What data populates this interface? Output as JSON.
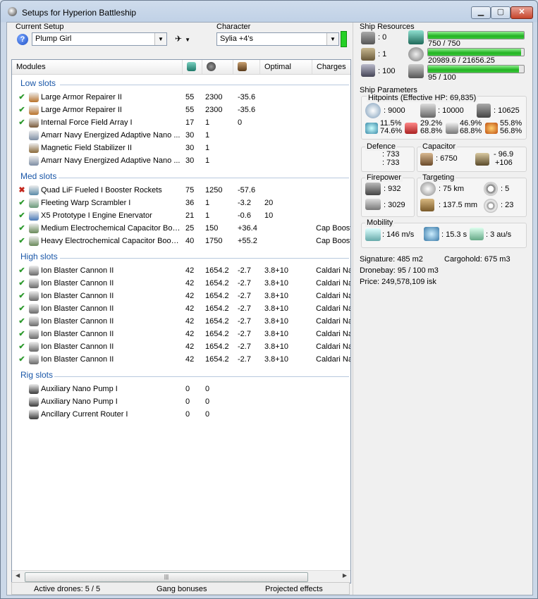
{
  "window": {
    "title": "Setups for Hyperion Battleship"
  },
  "setup": {
    "label": "Current Setup",
    "value": "Plump Girl"
  },
  "character": {
    "label": "Character",
    "value": "Sylia +4's"
  },
  "columns": {
    "modules": "Modules",
    "optimal": "Optimal",
    "charges": "Charges"
  },
  "groups": {
    "low": "Low slots",
    "med": "Med slots",
    "high": "High slots",
    "rig": "Rig slots"
  },
  "low": [
    {
      "s": "on",
      "name": "Large Armor Repairer II",
      "cpu": "55",
      "pg": "2300",
      "cap": "-35.6",
      "opt": "",
      "chg": "",
      "ic": "#b8732b"
    },
    {
      "s": "on",
      "name": "Large Armor Repairer II",
      "cpu": "55",
      "pg": "2300",
      "cap": "-35.6",
      "opt": "",
      "chg": "",
      "ic": "#b8732b"
    },
    {
      "s": "on",
      "name": "Internal Force Field Array I",
      "cpu": "17",
      "pg": "1",
      "cap": "0",
      "opt": "",
      "chg": "",
      "ic": "#7a5a3a"
    },
    {
      "s": "",
      "name": "Amarr Navy Energized Adaptive Nano ...",
      "cpu": "30",
      "pg": "1",
      "cap": "",
      "opt": "",
      "chg": "",
      "ic": "#7e8ea4"
    },
    {
      "s": "",
      "name": "Magnetic Field Stabilizer II",
      "cpu": "30",
      "pg": "1",
      "cap": "",
      "opt": "",
      "chg": "",
      "ic": "#8a6a3a"
    },
    {
      "s": "",
      "name": "Amarr Navy Energized Adaptive Nano ...",
      "cpu": "30",
      "pg": "1",
      "cap": "",
      "opt": "",
      "chg": "",
      "ic": "#7e8ea4"
    }
  ],
  "med": [
    {
      "s": "off",
      "name": "Quad LiF Fueled I Booster Rockets",
      "cpu": "75",
      "pg": "1250",
      "cap": "-57.6",
      "opt": "",
      "chg": "",
      "ic": "#5a8aa8"
    },
    {
      "s": "on",
      "name": "Fleeting Warp Scrambler I",
      "cpu": "36",
      "pg": "1",
      "cap": "-3.2",
      "opt": "20",
      "chg": "",
      "ic": "#6a9a7a"
    },
    {
      "s": "on",
      "name": "X5 Prototype I Engine Enervator",
      "cpu": "21",
      "pg": "1",
      "cap": "-0.6",
      "opt": "10",
      "chg": "",
      "ic": "#4a7ab8"
    },
    {
      "s": "on",
      "name": "Medium Electrochemical Capacitor Boo...",
      "cpu": "25",
      "pg": "150",
      "cap": "+36.4",
      "opt": "",
      "chg": "Cap Booster",
      "ic": "#6a8a5a"
    },
    {
      "s": "on",
      "name": "Heavy Electrochemical Capacitor Boost...",
      "cpu": "40",
      "pg": "1750",
      "cap": "+55.2",
      "opt": "",
      "chg": "Cap Booster",
      "ic": "#6a8a5a"
    }
  ],
  "high": [
    {
      "s": "on",
      "name": "Ion Blaster Cannon II",
      "cpu": "42",
      "pg": "1654.2",
      "cap": "-2.7",
      "opt": "3.8+10",
      "chg": "Caldari Navy",
      "ic": "#6a6a6a"
    },
    {
      "s": "on",
      "name": "Ion Blaster Cannon II",
      "cpu": "42",
      "pg": "1654.2",
      "cap": "-2.7",
      "opt": "3.8+10",
      "chg": "Caldari Navy",
      "ic": "#6a6a6a"
    },
    {
      "s": "on",
      "name": "Ion Blaster Cannon II",
      "cpu": "42",
      "pg": "1654.2",
      "cap": "-2.7",
      "opt": "3.8+10",
      "chg": "Caldari Navy",
      "ic": "#6a6a6a"
    },
    {
      "s": "on",
      "name": "Ion Blaster Cannon II",
      "cpu": "42",
      "pg": "1654.2",
      "cap": "-2.7",
      "opt": "3.8+10",
      "chg": "Caldari Navy",
      "ic": "#6a6a6a"
    },
    {
      "s": "on",
      "name": "Ion Blaster Cannon II",
      "cpu": "42",
      "pg": "1654.2",
      "cap": "-2.7",
      "opt": "3.8+10",
      "chg": "Caldari Navy",
      "ic": "#6a6a6a"
    },
    {
      "s": "on",
      "name": "Ion Blaster Cannon II",
      "cpu": "42",
      "pg": "1654.2",
      "cap": "-2.7",
      "opt": "3.8+10",
      "chg": "Caldari Navy",
      "ic": "#6a6a6a"
    },
    {
      "s": "on",
      "name": "Ion Blaster Cannon II",
      "cpu": "42",
      "pg": "1654.2",
      "cap": "-2.7",
      "opt": "3.8+10",
      "chg": "Caldari Navy",
      "ic": "#6a6a6a"
    },
    {
      "s": "on",
      "name": "Ion Blaster Cannon II",
      "cpu": "42",
      "pg": "1654.2",
      "cap": "-2.7",
      "opt": "3.8+10",
      "chg": "Caldari Navy",
      "ic": "#6a6a6a"
    }
  ],
  "rig": [
    {
      "s": "",
      "name": "Auxiliary Nano Pump I",
      "cpu": "0",
      "pg": "0",
      "cap": "",
      "opt": "",
      "chg": "",
      "ic": "#3a3a3a"
    },
    {
      "s": "",
      "name": "Auxiliary Nano Pump I",
      "cpu": "0",
      "pg": "0",
      "cap": "",
      "opt": "",
      "chg": "",
      "ic": "#3a3a3a"
    },
    {
      "s": "",
      "name": "Ancillary Current Router I",
      "cpu": "0",
      "pg": "0",
      "cap": "",
      "opt": "",
      "chg": "",
      "ic": "#3a3a3a"
    }
  ],
  "status": {
    "drones": "Active drones: 5 / 5",
    "gang": "Gang bonuses",
    "projected": "Projected effects"
  },
  "resources": {
    "title": "Ship Resources",
    "turrets": ": 0",
    "launchers": ": 1",
    "calibration": ": 100",
    "cpu": "750 / 750",
    "cpu_fill": 1.0,
    "pg": "20989.6 / 21656.25",
    "pg_fill": 0.97,
    "drone": "95 / 100",
    "drone_fill": 0.95
  },
  "params": {
    "title": "Ship Parameters",
    "hp_title": "Hitpoints (Effective HP: 69,835)",
    "shield_hp": ": 9000",
    "armor_hp": ": 10000",
    "hull_hp": ": 10625",
    "res": [
      [
        "11.5%",
        "74.6%"
      ],
      [
        "29.2%",
        "68.8%"
      ],
      [
        "46.9%",
        "68.8%"
      ],
      [
        "55.8%",
        "56.8%"
      ]
    ],
    "defence": {
      "title": "Defence",
      "a": ": 733",
      "b": ": 733"
    },
    "capacitor": {
      "title": "Capacitor",
      "cap": ": 6750",
      "rate": "- 96.9",
      "rate2": "+106"
    },
    "firepower": {
      "title": "Firepower",
      "turret": ": 932",
      "volley": ": 3029"
    },
    "targeting": {
      "title": "Targeting",
      "range": ": 75 km",
      "targets": ": 5",
      "res": ": 137.5 mm",
      "scan": ": 23"
    },
    "mobility": {
      "title": "Mobility",
      "speed": ": 146 m/s",
      "align": ": 15.3 s",
      "warp": ": 3 au/s"
    },
    "signature": "Signature: 485 m2",
    "cargohold": "Cargohold: 675 m3",
    "dronebay": "Dronebay: 95 / 100 m3",
    "price": "Price: 249,578,109 isk"
  }
}
